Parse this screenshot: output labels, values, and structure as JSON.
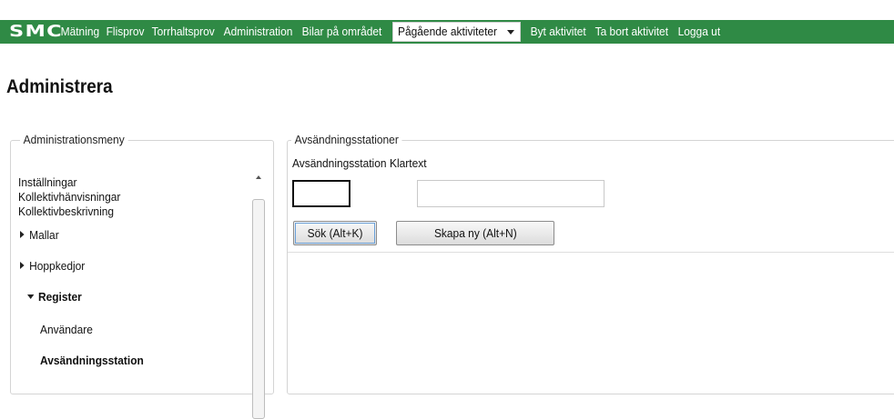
{
  "topbar": {
    "logo": "SMC",
    "items": [
      "Mätning",
      "Flisprov",
      "Torrhaltsprov",
      "Administration",
      "Bilar på området"
    ],
    "dropdown_label": "Pågående aktiviteter",
    "right_items": [
      "Byt aktivitet",
      "Ta bort aktivitet",
      "Logga ut"
    ],
    "color": "#2f8a45"
  },
  "page": {
    "title": "Administrera"
  },
  "menu": {
    "legend": "Administrationsmeny",
    "items": [
      {
        "label": "Inställningar"
      },
      {
        "label": "Kollektivhänvisningar"
      },
      {
        "label": "Kollektivbeskrivning"
      },
      {
        "label": "Mallar",
        "icon": "triangle-right-icon"
      },
      {
        "label": "Hoppkedjor",
        "icon": "triangle-right-icon"
      },
      {
        "label": "Register",
        "icon": "triangle-down-icon"
      },
      {
        "label": "Användare"
      },
      {
        "label": "Avsändningsstation"
      }
    ]
  },
  "form": {
    "legend": "Avsändningsstationer",
    "station_label": "Avsändningsstation",
    "klartext_label": "Klartext",
    "station_value": "",
    "klartext_value": "",
    "search_button": "Sök (Alt+K)",
    "create_button": "Skapa ny (Alt+N)"
  }
}
